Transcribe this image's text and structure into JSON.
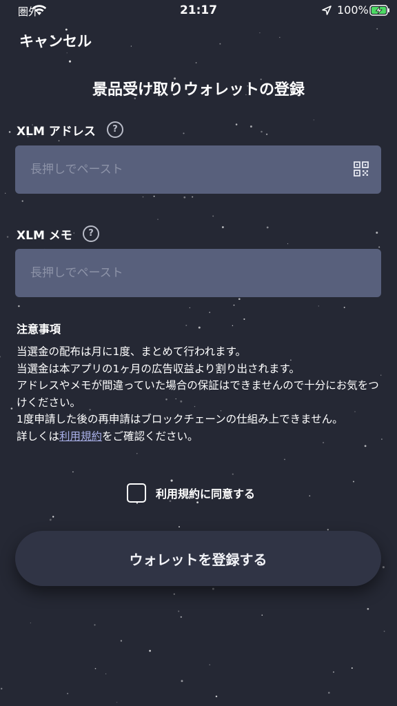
{
  "status_bar": {
    "carrier": "圏外",
    "time": "21:17",
    "battery_percent": "100%"
  },
  "nav": {
    "cancel_label": "キャンセル"
  },
  "page": {
    "title": "景品受け取りウォレットの登録"
  },
  "form": {
    "address_label": "XLM アドレス",
    "address_placeholder": "長押しでペースト",
    "memo_label": "XLM メモ",
    "memo_placeholder": "長押しでペースト",
    "help_glyph": "?"
  },
  "notes": {
    "title": "注意事項",
    "lines": [
      "当選金の配布は月に1度、まとめて行われます。",
      "当選金は本アプリの1ヶ月の広告収益より割り出されます。",
      "アドレスやメモが間違っていた場合の保証はできませんので十分にお気をつけください。",
      "1度申請した後の再申請はブロックチェーンの仕組み上できません。"
    ],
    "details_prefix": "詳しくは",
    "details_link": "利用規約",
    "details_suffix": "をご確認ください。"
  },
  "agreement": {
    "label": "利用規約に同意する",
    "checked": false
  },
  "submit": {
    "label": "ウォレットを登録する"
  },
  "colors": {
    "background": "#252834",
    "input_background": "#58607c",
    "link": "#a9b0e8",
    "button": "#303445",
    "battery": "#4cd964"
  }
}
